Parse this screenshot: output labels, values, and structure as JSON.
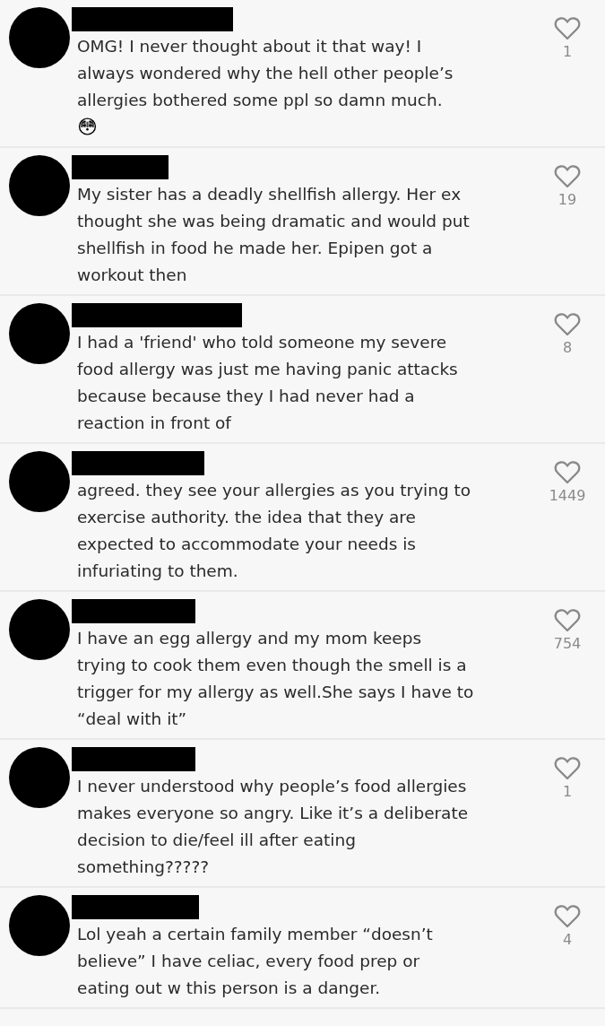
{
  "comments": [
    {
      "text": "OMG! I never thought about it that way! I\nalways wondered why the hell other people’s\nallergies bothered some ppl so damn much.",
      "emoji": "😳",
      "likes": "1"
    },
    {
      "text": "My sister has a deadly shellfish allergy. Her ex\nthought she was being dramatic and would put\nshellfish in food he made her. Epipen got a\nworkout then",
      "likes": "19"
    },
    {
      "text": "I had a 'friend' who told someone my severe\nfood allergy was just me having panic attacks\nbecause because they I had never had a\nreaction in front of",
      "likes": "8"
    },
    {
      "text": "agreed. they see your allergies as you trying to\nexercise authority. the idea that they are\nexpected to accommodate your needs is\ninfuriating to them.",
      "likes": "1449"
    },
    {
      "text": "I have an egg allergy and my mom keeps\ntrying to cook them even though the smell is a\ntrigger for my allergy as well.She says I have to\n“deal with it”",
      "likes": "754"
    },
    {
      "text": "I never understood why people’s food allergies\nmakes everyone so angry. Like it’s a deliberate\ndecision to die/feel ill after eating\nsomething?????",
      "likes": "1"
    },
    {
      "text": "Lol yeah a certain family member “doesn’t\nbelieve” I have celiac, every food prep or\neating out w this person is a danger.",
      "likes": "4"
    }
  ]
}
